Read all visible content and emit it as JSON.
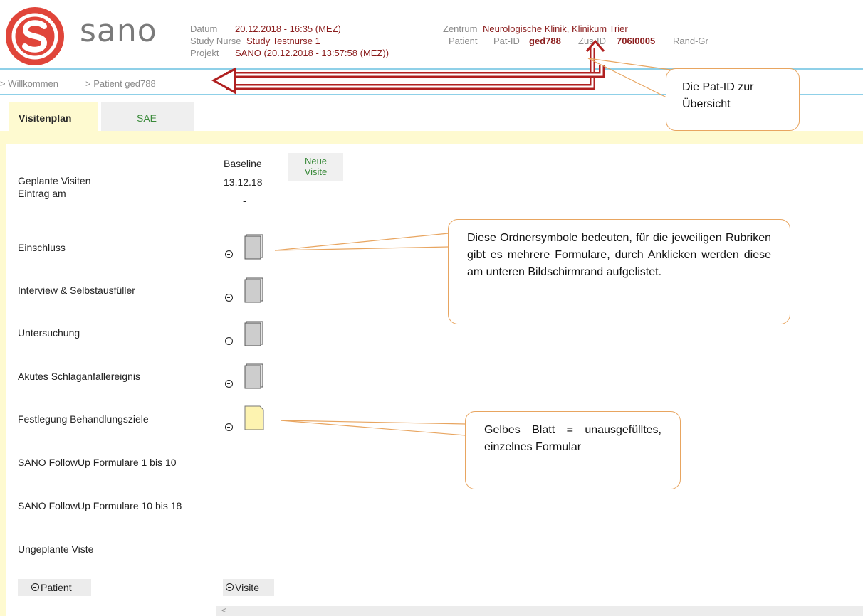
{
  "brand": {
    "name": "sano"
  },
  "header": {
    "datum_label": "Datum",
    "datum_value": "20.12.2018 - 16:35 (MEZ)",
    "nurse_label": "Study Nurse",
    "nurse_value": "Study Testnurse 1",
    "projekt_label": "Projekt",
    "projekt_value": "SANO (20.12.2018 - 13:57:58 (MEZ))",
    "zentrum_label": "Zentrum",
    "zentrum_value": "Neurologische Klinik, Klinikum Trier",
    "patient_label": "Patient",
    "patid_label": "Pat-ID",
    "patid_value": "ged788",
    "zusid_label": "Zus-ID",
    "zusid_value": "706I0005",
    "randgr_label": "Rand-Gr"
  },
  "breadcrumb": {
    "item1": "> Willkommen",
    "item2": "> Patient ged788"
  },
  "tabs": {
    "active": "Visitenplan",
    "inactive": "SAE"
  },
  "visit": {
    "name": "Baseline",
    "date": "13.12.18",
    "dash": "-",
    "new_visit_line1": "Neue",
    "new_visit_line2": "Visite"
  },
  "rows": {
    "geplante": "Geplante Visiten",
    "eintrag": "Eintrag am",
    "einschluss": "Einschluss",
    "interview": "Interview & Selbstausfüller",
    "untersuchung": "Untersuchung",
    "akutes": "Akutes Schlaganfallereignis",
    "festlegung": "Festlegung Behandlungsziele",
    "followup1": "SANO FollowUp Formulare 1 bis 10",
    "followup2": "SANO FollowUp Formulare 10 bis 18",
    "ungeplante": "Ungeplante Viste"
  },
  "buttons": {
    "patient": "Patient",
    "visite": "Visite"
  },
  "callouts": {
    "patid": "Die Pat-ID zur Übersicht",
    "folder": "Diese Ordnersymbole bedeuten, für die jeweiligen Rubriken gibt es mehrere Formulare, durch Anklicken werden diese am unteren Bildschirmrand aufgelistet.",
    "yellow": "Gelbes Blatt = unausgefülltes, einzelnes Formular"
  },
  "scroll": {
    "arrow": "<"
  },
  "colors": {
    "brand_red": "#e0453a",
    "value_red": "#8b1d1d",
    "tab_yellow": "#fefad0",
    "link_green": "#3a8a3a",
    "callout_border": "#e8a560",
    "arrow_red": "#b02020",
    "divider_blue": "#8fd0e8"
  }
}
